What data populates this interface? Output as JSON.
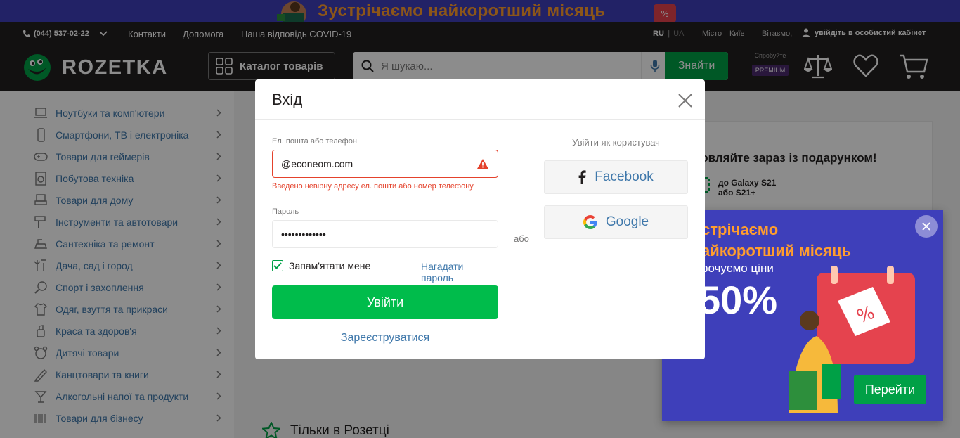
{
  "promo": {
    "text": "Зустрічаємо найкоротший місяць"
  },
  "header": {
    "phone": "(044) 537-02-22",
    "nav": [
      "Контакти",
      "Допомога",
      "Наша відповідь COVID-19"
    ],
    "lang_ru": "RU",
    "lang_ua": "UA",
    "lang_sep": "|",
    "city_label": "Місто",
    "city": "Київ",
    "greeting": "Вітаємо,",
    "login": "увійдіть в особистий кабінет",
    "logo": "ROZETKA",
    "catalog": "Каталог товарів",
    "search_placeholder": "Я шукаю...",
    "search_button": "Знайти",
    "premium_try": "Спробуйте",
    "premium_badge": "PREMIUM"
  },
  "sidebar": {
    "items": [
      {
        "label": "Ноутбуки та комп'ютери",
        "icon": "laptop-icon"
      },
      {
        "label": "Смартфони, ТВ і електроніка",
        "icon": "smartphone-icon"
      },
      {
        "label": "Товари для геймерів",
        "icon": "gamepad-icon"
      },
      {
        "label": "Побутова техніка",
        "icon": "washing-machine-icon"
      },
      {
        "label": "Товари для дому",
        "icon": "furniture-icon"
      },
      {
        "label": "Інструменти та автотовари",
        "icon": "tools-icon"
      },
      {
        "label": "Сантехніка та ремонт",
        "icon": "faucet-icon"
      },
      {
        "label": "Дача, сад і город",
        "icon": "garden-icon"
      },
      {
        "label": "Спорт і захоплення",
        "icon": "sport-icon"
      },
      {
        "label": "Одяг, взуття та прикраси",
        "icon": "clothes-icon"
      },
      {
        "label": "Краса та здоров'я",
        "icon": "beauty-icon"
      },
      {
        "label": "Дитячі товари",
        "icon": "kids-icon"
      },
      {
        "label": "Канцтовари та книги",
        "icon": "stationery-icon"
      },
      {
        "label": "Алкогольні напої та продукти",
        "icon": "drinks-icon"
      },
      {
        "label": "Товари для бізнесу",
        "icon": "barcode-icon"
      }
    ]
  },
  "content": {
    "banner_title": "новляйте зараз із подарунком!",
    "banner_sub": "до Galaxy S21\nабо S21+",
    "section_title": "Тільки в Розетці"
  },
  "popup": {
    "title": "стрічаємо\nайкоротший місяць",
    "subtitle": "рочуємо ціни",
    "percent": "50%",
    "button": "Перейти"
  },
  "modal": {
    "title": "Вхід",
    "email_label": "Ел. пошта або телефон",
    "email_value": "@econeom.com",
    "email_error": "Введено невірну адресу ел. пошти або номер телефону",
    "password_label": "Пароль",
    "password_value": "•••••••••••••",
    "remember": "Запам'ятати мене",
    "remember_checked": true,
    "forgot": "Нагадати пароль",
    "submit": "Увійти",
    "register": "Зареєструватися",
    "or": "або",
    "login_as": "Увійти як користувач",
    "facebook": "Facebook",
    "google": "Google"
  },
  "colors": {
    "header_bg": "#221f1f",
    "brand_green": "#00a046",
    "submit_green": "#00bc4b",
    "link_blue": "#3e77aa",
    "error_red": "#e4422c",
    "promo_blue": "#3e3fba",
    "promo_orange": "#ff9d2e"
  }
}
